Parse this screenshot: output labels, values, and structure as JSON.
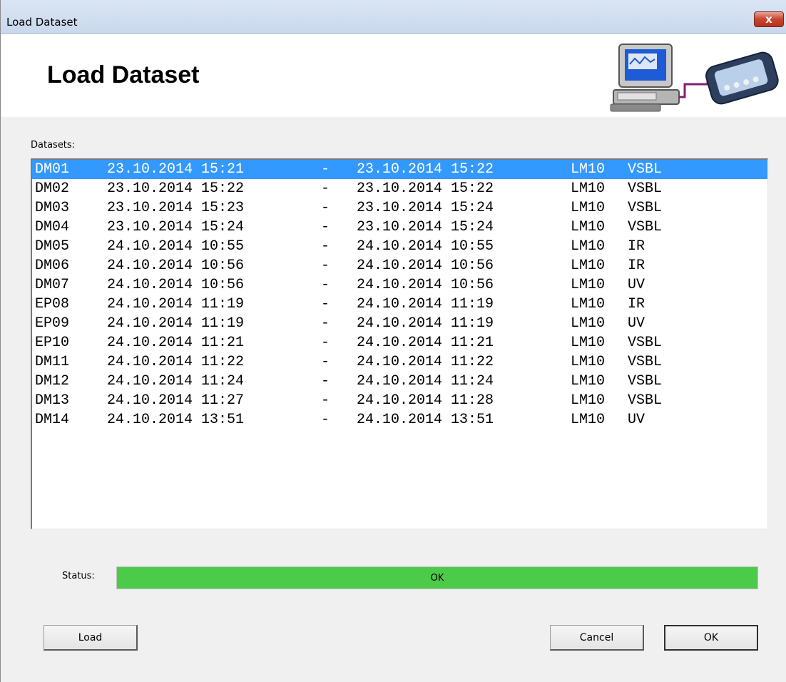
{
  "window": {
    "title": "Load Dataset",
    "close_label": "x"
  },
  "header": {
    "title": "Load Dataset",
    "art_icon": "computer-to-device-icon"
  },
  "datasets": {
    "label": "Datasets:",
    "selected_index": 0,
    "rows": [
      {
        "id": "DM01",
        "start": "23.10.2014 15:21",
        "dash": "-",
        "end": "23.10.2014 15:22",
        "device": "LM10",
        "type": "VSBL"
      },
      {
        "id": "DM02",
        "start": "23.10.2014 15:22",
        "dash": "-",
        "end": "23.10.2014 15:22",
        "device": "LM10",
        "type": "VSBL"
      },
      {
        "id": "DM03",
        "start": "23.10.2014 15:23",
        "dash": "-",
        "end": "23.10.2014 15:24",
        "device": "LM10",
        "type": "VSBL"
      },
      {
        "id": "DM04",
        "start": "23.10.2014 15:24",
        "dash": "-",
        "end": "23.10.2014 15:24",
        "device": "LM10",
        "type": "VSBL"
      },
      {
        "id": "DM05",
        "start": "24.10.2014 10:55",
        "dash": "-",
        "end": "24.10.2014 10:55",
        "device": "LM10",
        "type": "IR"
      },
      {
        "id": "DM06",
        "start": "24.10.2014 10:56",
        "dash": "-",
        "end": "24.10.2014 10:56",
        "device": "LM10",
        "type": "IR"
      },
      {
        "id": "DM07",
        "start": "24.10.2014 10:56",
        "dash": "-",
        "end": "24.10.2014 10:56",
        "device": "LM10",
        "type": "UV"
      },
      {
        "id": "EP08",
        "start": "24.10.2014 11:19",
        "dash": "-",
        "end": "24.10.2014 11:19",
        "device": "LM10",
        "type": "IR"
      },
      {
        "id": "EP09",
        "start": "24.10.2014 11:19",
        "dash": "-",
        "end": "24.10.2014 11:19",
        "device": "LM10",
        "type": "UV"
      },
      {
        "id": "EP10",
        "start": "24.10.2014 11:21",
        "dash": "-",
        "end": "24.10.2014 11:21",
        "device": "LM10",
        "type": "VSBL"
      },
      {
        "id": "DM11",
        "start": "24.10.2014 11:22",
        "dash": "-",
        "end": "24.10.2014 11:22",
        "device": "LM10",
        "type": "VSBL"
      },
      {
        "id": "DM12",
        "start": "24.10.2014 11:24",
        "dash": "-",
        "end": "24.10.2014 11:24",
        "device": "LM10",
        "type": "VSBL"
      },
      {
        "id": "DM13",
        "start": "24.10.2014 11:27",
        "dash": "-",
        "end": "24.10.2014 11:28",
        "device": "LM10",
        "type": "VSBL"
      },
      {
        "id": "DM14",
        "start": "24.10.2014 13:51",
        "dash": "-",
        "end": "24.10.2014 13:51",
        "device": "LM10",
        "type": "UV"
      }
    ]
  },
  "status": {
    "label": "Status:",
    "text": "OK",
    "progress": 1.0,
    "fill_color": "#4ccb4a"
  },
  "buttons": {
    "load": "Load",
    "cancel": "Cancel",
    "ok": "OK"
  },
  "colors": {
    "selection": "#3399ff",
    "header_bg": "#ffffff",
    "window_bg": "#f0f0f0"
  }
}
